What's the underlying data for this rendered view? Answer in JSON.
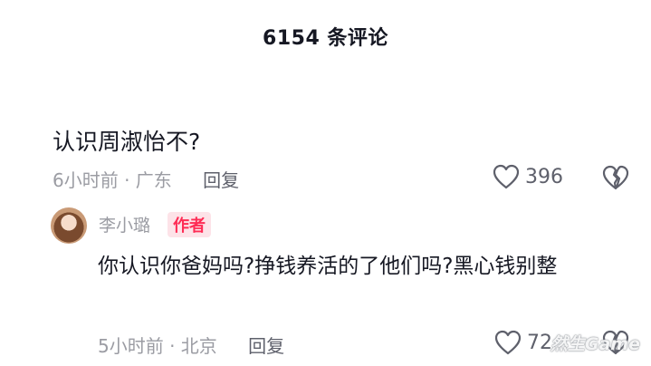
{
  "header": {
    "title": "6154 条评论"
  },
  "comment": {
    "text": "认识周淑怡不?",
    "meta": "6小时前 · 广东",
    "reply_label": "回复",
    "likes": "396"
  },
  "reply": {
    "name": "李小璐",
    "badge": "作者",
    "text": "你认识你爸妈吗?挣钱养活的了他们吗?黑心钱别整",
    "meta": "5小时前 · 北京",
    "reply_label": "回复",
    "likes": "72"
  },
  "watermark": "然生Game",
  "colors": {
    "badge": "#fe2c55",
    "meta": "#9b9ca3",
    "text": "#161823"
  },
  "icons": [
    "heart-icon",
    "broken-heart-icon",
    "avatar"
  ]
}
